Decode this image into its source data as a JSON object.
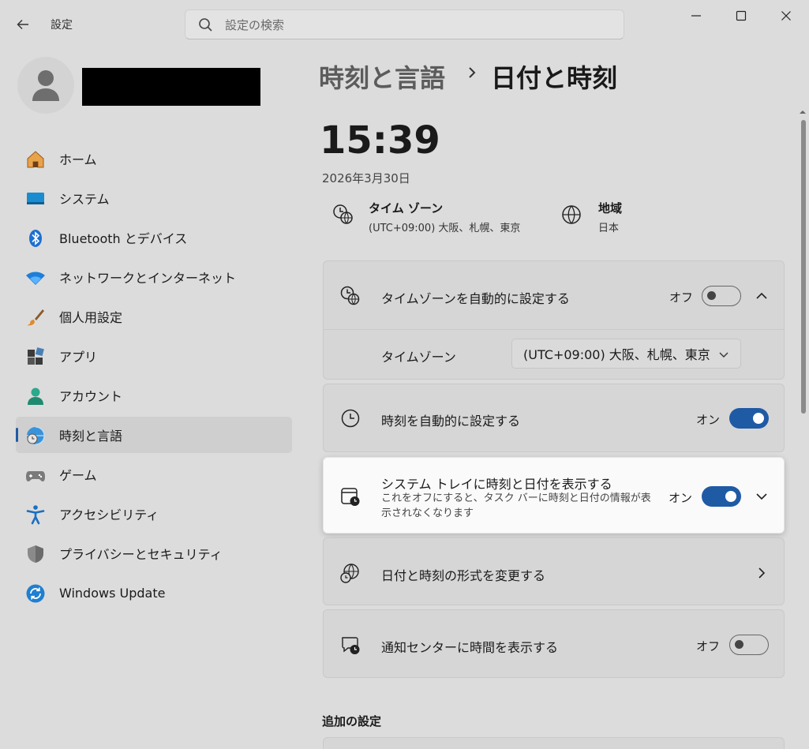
{
  "window": {
    "app_title": "設定",
    "search_placeholder": "設定の検索"
  },
  "sidebar": {
    "items": [
      {
        "label": "ホーム",
        "icon": "home-icon"
      },
      {
        "label": "システム",
        "icon": "system-icon"
      },
      {
        "label": "Bluetooth とデバイス",
        "icon": "bluetooth-icon"
      },
      {
        "label": "ネットワークとインターネット",
        "icon": "wifi-icon"
      },
      {
        "label": "個人用設定",
        "icon": "brush-icon"
      },
      {
        "label": "アプリ",
        "icon": "apps-icon"
      },
      {
        "label": "アカウント",
        "icon": "account-icon"
      },
      {
        "label": "時刻と言語",
        "icon": "time-language-icon",
        "active": true
      },
      {
        "label": "ゲーム",
        "icon": "gamepad-icon"
      },
      {
        "label": "アクセシビリティ",
        "icon": "accessibility-icon"
      },
      {
        "label": "プライバシーとセキュリティ",
        "icon": "shield-icon"
      },
      {
        "label": "Windows Update",
        "icon": "update-icon"
      }
    ]
  },
  "header": {
    "parent": "時刻と言語",
    "current": "日付と時刻"
  },
  "clock": {
    "time": "15:39",
    "date": "2026年3月30日"
  },
  "info": {
    "timezone_title": "タイム ゾーン",
    "timezone_value": "(UTC+09:00) 大阪、札幌、東京",
    "region_title": "地域",
    "region_value": "日本"
  },
  "settings": {
    "auto_timezone": {
      "label": "タイムゾーンを自動的に設定する",
      "state": "オフ",
      "on": false
    },
    "timezone_select": {
      "label": "タイムゾーン",
      "value": "(UTC+09:00) 大阪、札幌、東京"
    },
    "auto_time": {
      "label": "時刻を自動的に設定する",
      "state": "オン",
      "on": true
    },
    "systray": {
      "label": "システム トレイに時刻と日付を表示する",
      "desc": "これをオフにすると、タスク バーに時刻と日付の情報が表示されなくなります",
      "state": "オン",
      "on": true
    },
    "format": {
      "label": "日付と時刻の形式を変更する"
    },
    "notification": {
      "label": "通知センターに時間を表示する",
      "state": "オフ",
      "on": false
    }
  },
  "additional": {
    "title": "追加の設定"
  },
  "colors": {
    "accent": "#1f5aa5",
    "background": "#dcdcdc"
  }
}
